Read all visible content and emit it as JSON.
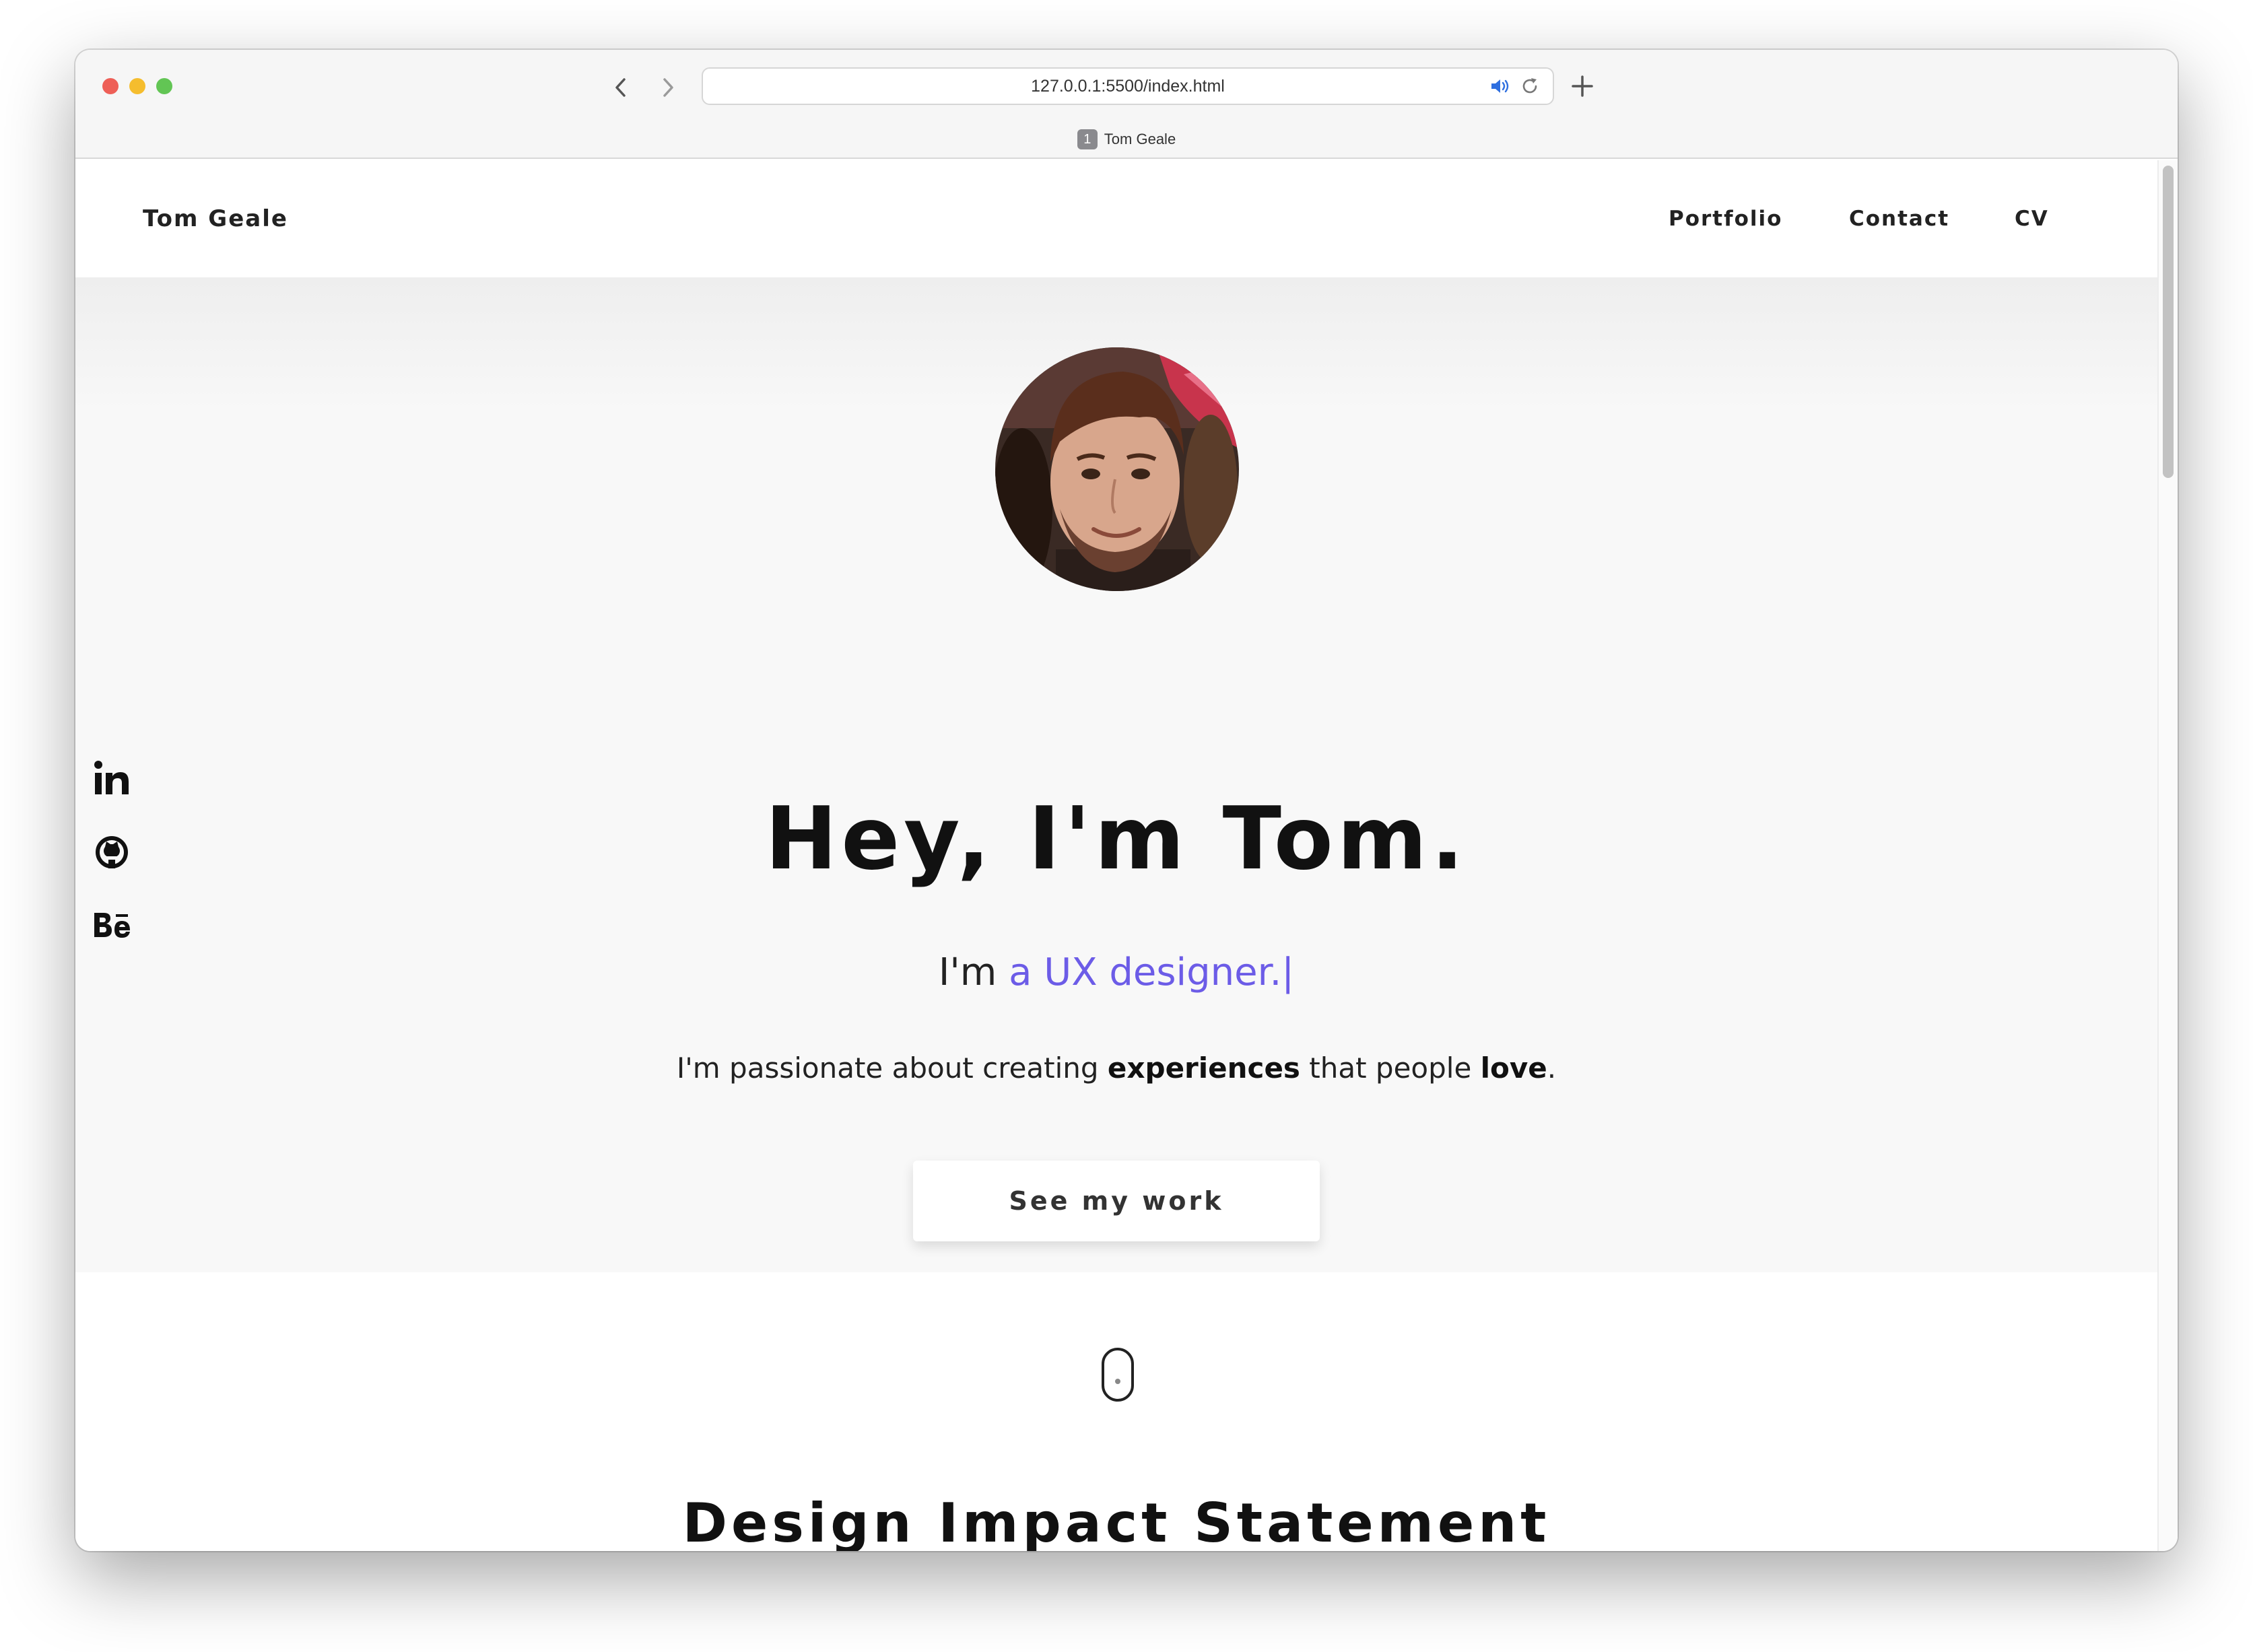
{
  "browser": {
    "url": "127.0.0.1:5500/index.html",
    "tab_index": "1",
    "tab_title": "Tom Geale",
    "icons": [
      "back-chevron-icon",
      "forward-chevron-icon",
      "speaker-icon",
      "reload-icon",
      "plus-icon"
    ]
  },
  "site_nav": {
    "brand": "Tom Geale",
    "links": [
      "Portfolio",
      "Contact",
      "CV"
    ]
  },
  "social": {
    "icons": [
      "linkedin-icon",
      "github-icon",
      "behance-icon"
    ]
  },
  "hero": {
    "title": "Hey, I'm Tom.",
    "typed_prefix": "I'm ",
    "typed_role": "a UX designer.|",
    "tagline": {
      "part1": "I'm passionate about creating ",
      "bold1": "experiences",
      "part2": " that people ",
      "bold2": "love",
      "part3": "."
    },
    "cta_label": "See my work",
    "scroll_icon": "mouse-scroll-icon"
  },
  "section": {
    "title": "Design Impact Statement"
  },
  "colors": {
    "accent": "#6c5ce7",
    "hero_bg": "#f8f8f8",
    "text": "#111111"
  }
}
